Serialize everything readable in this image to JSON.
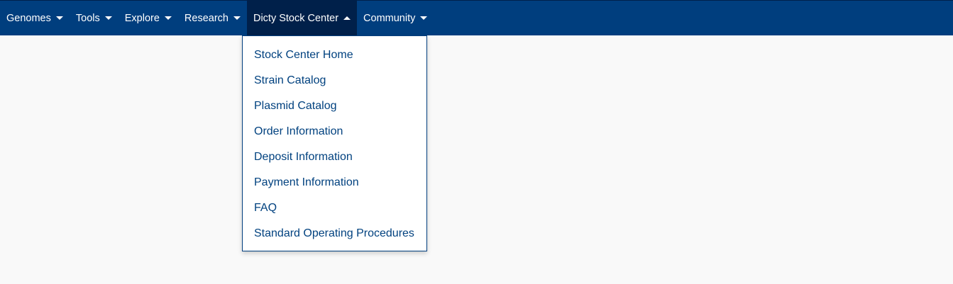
{
  "navbar": {
    "items": [
      {
        "label": "Genomes",
        "state": "collapsed"
      },
      {
        "label": "Tools",
        "state": "collapsed"
      },
      {
        "label": "Explore",
        "state": "collapsed"
      },
      {
        "label": "Research",
        "state": "collapsed"
      },
      {
        "label": "Dicty Stock Center",
        "state": "expanded"
      },
      {
        "label": "Community",
        "state": "collapsed"
      }
    ]
  },
  "dropdown": {
    "items": [
      "Stock Center Home",
      "Strain Catalog",
      "Plasmid Catalog",
      "Order Information",
      "Deposit Information",
      "Payment Information",
      "FAQ",
      "Standard Operating Procedures"
    ]
  },
  "colors": {
    "navbar_bg": "#003e7e",
    "navbar_active_bg": "#00204a",
    "link": "#00417f",
    "page_bg": "#f9f9f9"
  },
  "icons": {
    "collapsed": "caret-down-icon",
    "expanded": "caret-up-icon"
  }
}
